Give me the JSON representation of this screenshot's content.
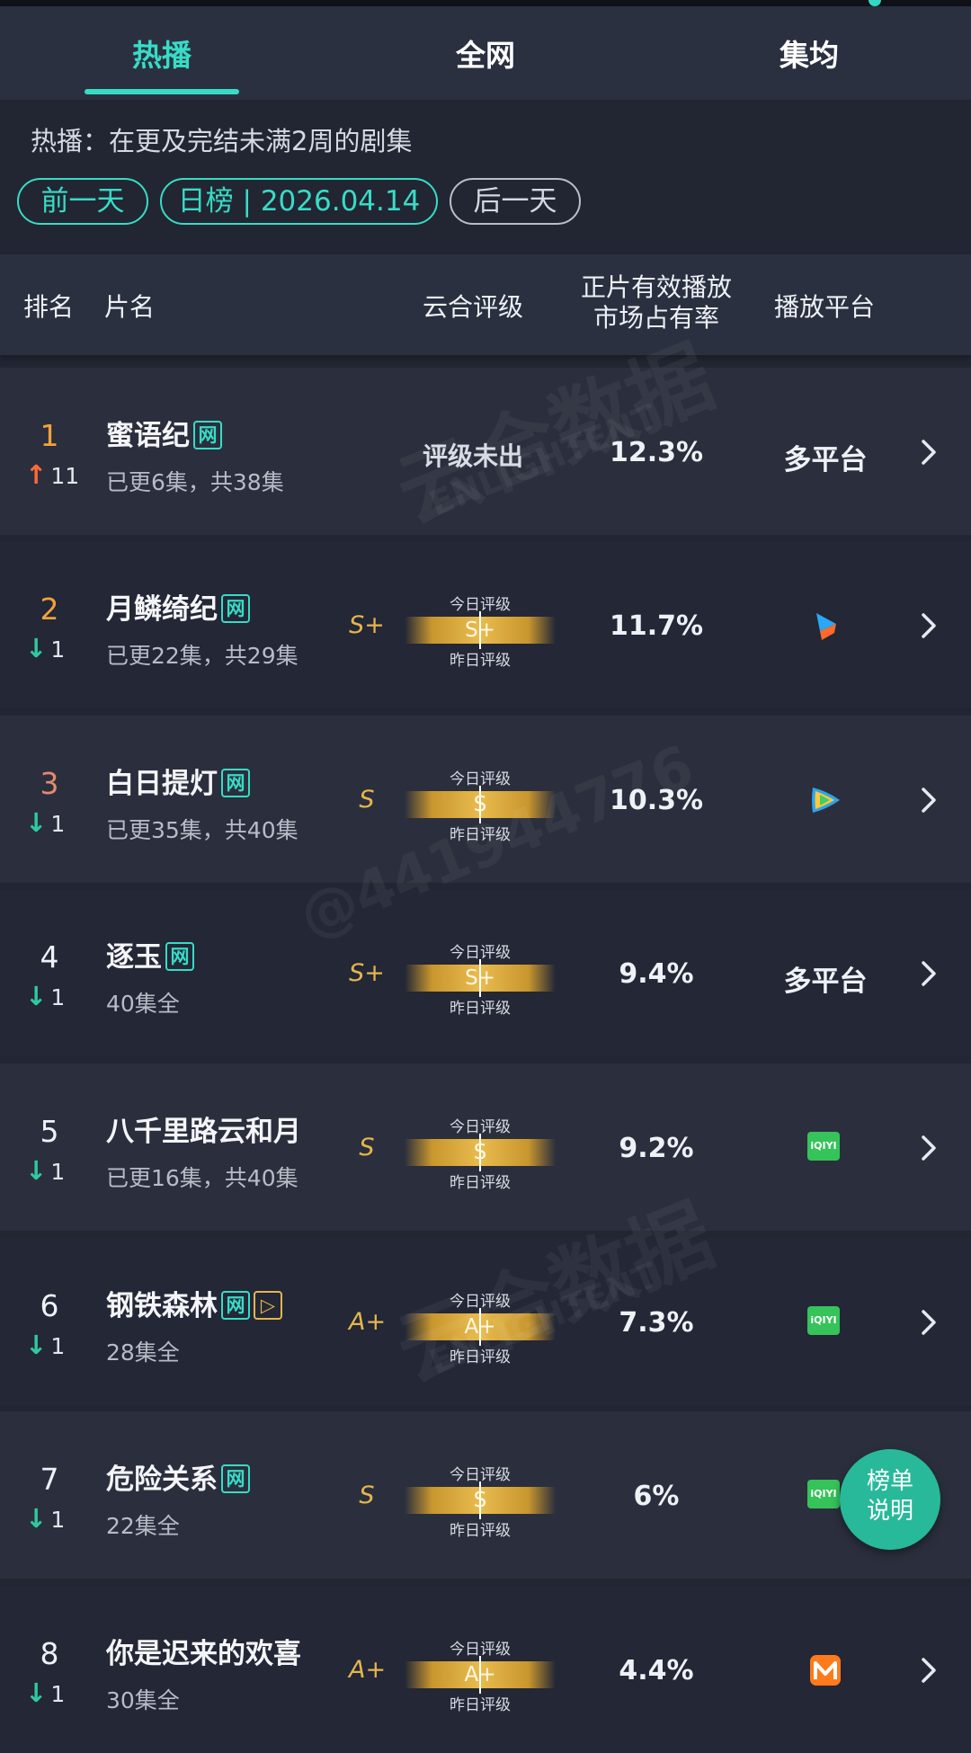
{
  "tabs": [
    "热播",
    "全网",
    "集均"
  ],
  "description": "热播：在更及完结未满2周的剧集",
  "date_nav": {
    "prev": "前一天",
    "current": "日榜 | 2026.04.14",
    "next": "后一天"
  },
  "table_headers": {
    "rank": "排名",
    "name": "片名",
    "grade": "云合评级",
    "share_line1": "正片有效播放",
    "share_line2": "市场占有率",
    "platform": "播放平台"
  },
  "grade_labels": {
    "today": "今日评级",
    "yesterday": "昨日评级"
  },
  "rows": [
    {
      "rank": "1",
      "direction": "up",
      "change": "11",
      "title": "蜜语纪",
      "badges": [
        "网"
      ],
      "sub": "已更6集，共38集",
      "grade_left": "",
      "grade_bar": "",
      "grade_text": "评级未出",
      "share": "12.3%",
      "platform_text": "多平台",
      "platform_icon": ""
    },
    {
      "rank": "2",
      "direction": "down",
      "change": "1",
      "title": "月鳞绮纪",
      "badges": [
        "网"
      ],
      "sub": "已更22集，共29集",
      "grade_left": "S+",
      "grade_bar": "S+",
      "grade_text": "",
      "share": "11.7%",
      "platform_text": "",
      "platform_icon": "youku-icon"
    },
    {
      "rank": "3",
      "direction": "down",
      "change": "1",
      "title": "白日提灯",
      "badges": [
        "网"
      ],
      "sub": "已更35集，共40集",
      "grade_left": "S",
      "grade_bar": "S",
      "grade_text": "",
      "share": "10.3%",
      "platform_text": "",
      "platform_icon": "tencent-video-icon"
    },
    {
      "rank": "4",
      "direction": "down",
      "change": "1",
      "title": "逐玉",
      "badges": [
        "网"
      ],
      "sub": "40集全",
      "grade_left": "S+",
      "grade_bar": "S+",
      "grade_text": "",
      "share": "9.4%",
      "platform_text": "多平台",
      "platform_icon": ""
    },
    {
      "rank": "5",
      "direction": "down",
      "change": "1",
      "title": "八千里路云和月",
      "badges": [],
      "sub": "已更16集，共40集",
      "grade_left": "S",
      "grade_bar": "S",
      "grade_text": "",
      "share": "9.2%",
      "platform_text": "",
      "platform_icon": "iqiyi-icon"
    },
    {
      "rank": "6",
      "direction": "down",
      "change": "1",
      "title": "钢铁森林",
      "badges": [
        "网",
        "▷"
      ],
      "sub": "28集全",
      "grade_left": "A+",
      "grade_bar": "A+",
      "grade_text": "",
      "share": "7.3%",
      "platform_text": "",
      "platform_icon": "iqiyi-icon"
    },
    {
      "rank": "7",
      "direction": "down",
      "change": "1",
      "title": "危险关系",
      "badges": [
        "网"
      ],
      "sub": "22集全",
      "grade_left": "S",
      "grade_bar": "S",
      "grade_text": "",
      "share": "6%",
      "platform_text": "",
      "platform_icon": "iqiyi-icon"
    },
    {
      "rank": "8",
      "direction": "down",
      "change": "1",
      "title": "你是迟来的欢喜",
      "badges": [],
      "sub": "30集全",
      "grade_left": "A+",
      "grade_bar": "A+",
      "grade_text": "",
      "share": "4.4%",
      "platform_text": "",
      "platform_icon": "mango-tv-icon"
    }
  ],
  "iqiyi_logo_text": "iQIYI",
  "fab": {
    "line1": "榜单",
    "line2": "说明"
  },
  "watermark": {
    "brand": "云合数据",
    "brand_en": "ENLIGHTENT",
    "handle": "@441944776"
  },
  "colors": {
    "accent": "#37dcc6",
    "gold": "#e5b64d",
    "up": "#ff6a3d",
    "down": "#2fc9a0",
    "rank_top3": [
      "#f0a23c",
      "#f0a23c",
      "#e38b6d"
    ]
  }
}
